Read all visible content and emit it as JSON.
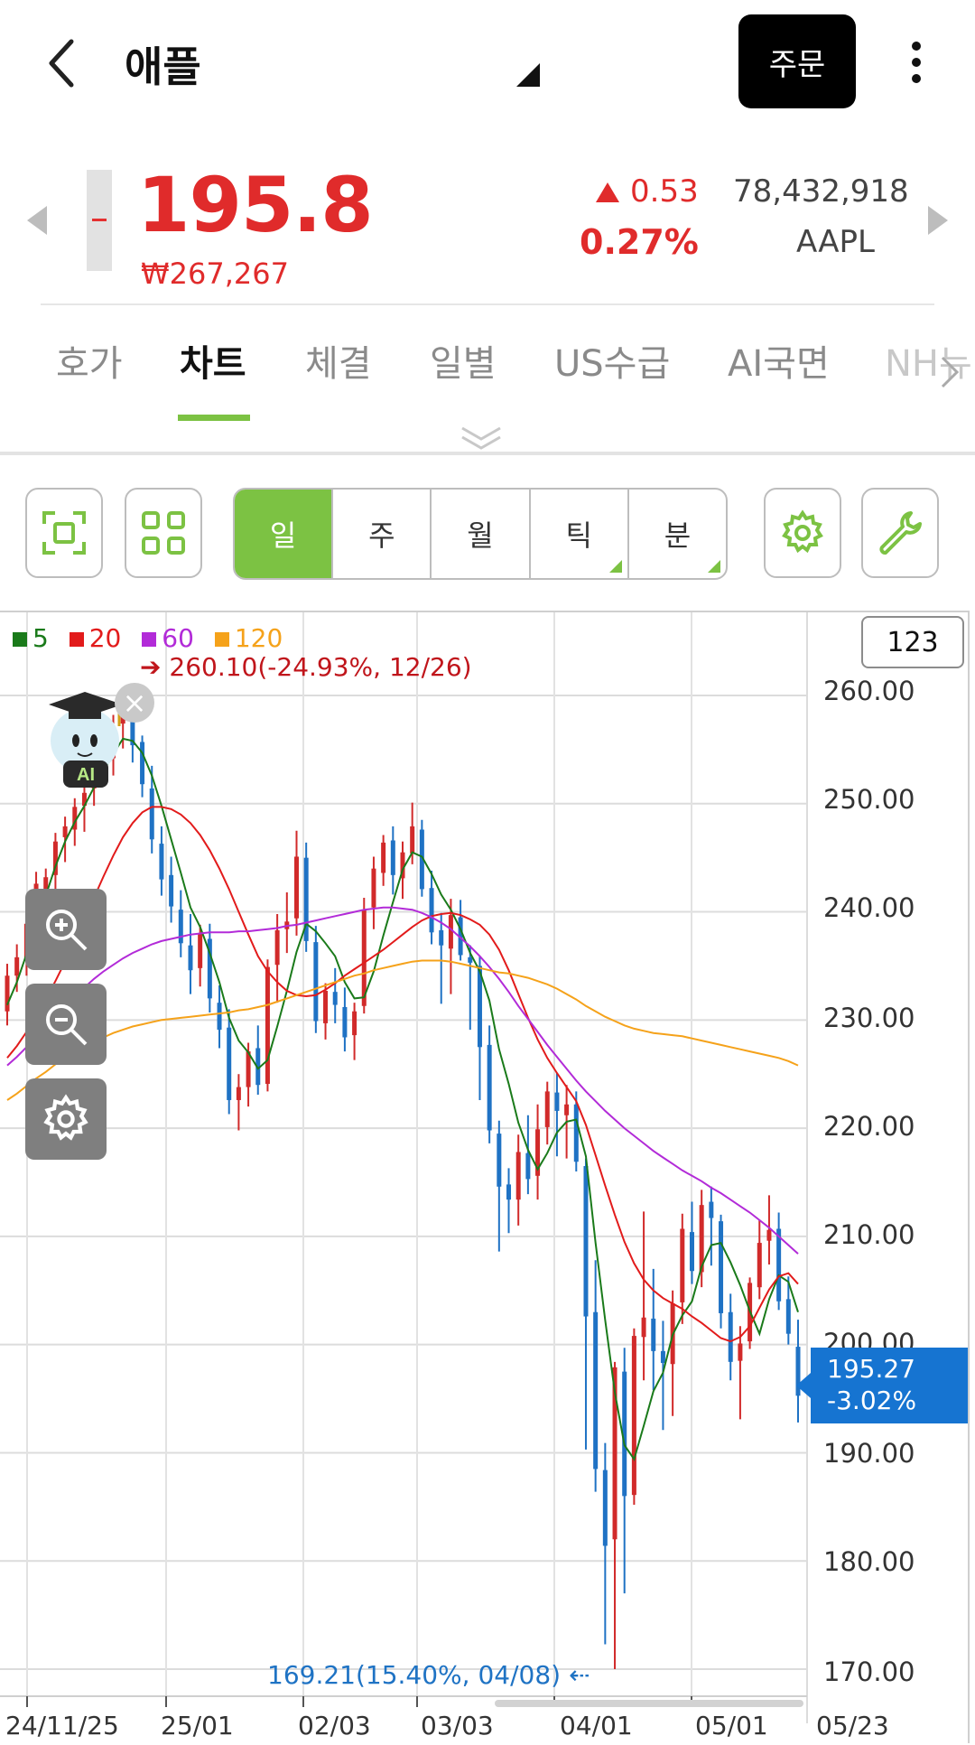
{
  "header": {
    "title": "애플",
    "order_label": "주문"
  },
  "quote": {
    "price": "195.8",
    "price_krw": "₩267,267",
    "change": "0.53",
    "change_pct": "0.27%",
    "volume": "78,432,918",
    "ticker": "AAPL"
  },
  "tabs": [
    "호가",
    "차트",
    "체결",
    "일별",
    "US수급",
    "AI국면",
    "NH뉴"
  ],
  "active_tab": "차트",
  "period_buttons": [
    "일",
    "주",
    "월",
    "틱",
    "분"
  ],
  "active_period": "일",
  "chart": {
    "legend": [
      {
        "label": "5",
        "color": "#1a7a1a"
      },
      {
        "label": "20",
        "color": "#e21b1b"
      },
      {
        "label": "60",
        "color": "#b22bd8"
      },
      {
        "label": "120",
        "color": "#f5a21a"
      }
    ],
    "count_button": "123",
    "high_note": "260.10(-24.93%, 12/26)",
    "low_note": "169.21(15.40%, 04/08)",
    "current_price": "195.27",
    "current_pct": "-3.02%",
    "ai_label": "AI"
  },
  "chart_data": {
    "type": "candlestick",
    "x_ticks": [
      "24/11/25",
      "25/01",
      "02/03",
      "03/03",
      "04/01",
      "05/01",
      "05/23"
    ],
    "y_ticks": [
      "260.00",
      "250.00",
      "240.00",
      "230.00",
      "220.00",
      "210.00",
      "200.00",
      "190.00",
      "180.00",
      "170.00"
    ],
    "ylim": [
      168,
      263
    ],
    "moving_averages": [
      "5",
      "20",
      "60",
      "120"
    ],
    "annotations": [
      "260.10(-24.93%, 12/26)",
      "169.21(15.40%, 04/08)"
    ],
    "last_value": 195.27,
    "up_color": "#d12a2a",
    "down_color": "#1f72c4",
    "candles": [
      [
        230.8,
        235.2,
        229.5,
        234.1
      ],
      [
        234.1,
        237.0,
        232.6,
        235.8
      ],
      [
        235.6,
        239.6,
        234.1,
        238.9
      ],
      [
        239.0,
        243.7,
        237.6,
        242.6
      ],
      [
        242.1,
        244.0,
        240.4,
        243.2
      ],
      [
        243.4,
        247.3,
        241.8,
        246.5
      ],
      [
        246.9,
        248.8,
        244.6,
        247.9
      ],
      [
        247.6,
        250.5,
        246.1,
        249.7
      ],
      [
        249.8,
        252.1,
        247.4,
        251.0
      ],
      [
        251.4,
        254.3,
        249.8,
        253.5
      ],
      [
        253.6,
        256.0,
        251.9,
        254.9
      ],
      [
        254.2,
        258.2,
        252.6,
        257.1
      ],
      [
        257.4,
        260.1,
        255.1,
        258.6
      ],
      [
        258.0,
        259.9,
        253.8,
        255.4
      ],
      [
        255.7,
        256.3,
        250.6,
        251.8
      ],
      [
        251.4,
        253.5,
        245.4,
        246.7
      ],
      [
        246.3,
        247.9,
        241.5,
        243.0
      ],
      [
        243.4,
        245.1,
        239.0,
        240.5
      ],
      [
        240.2,
        242.0,
        235.8,
        237.1
      ],
      [
        236.9,
        239.8,
        232.4,
        234.6
      ],
      [
        234.8,
        238.8,
        233.1,
        238.0
      ],
      [
        237.5,
        238.9,
        230.7,
        232.0
      ],
      [
        231.6,
        233.2,
        227.4,
        229.1
      ],
      [
        229.3,
        231.0,
        221.3,
        222.6
      ],
      [
        222.6,
        225.0,
        219.8,
        223.8
      ],
      [
        223.8,
        227.9,
        222.0,
        227.1
      ],
      [
        227.4,
        229.5,
        223.1,
        224.0
      ],
      [
        224.1,
        235.6,
        223.4,
        234.9
      ],
      [
        235.1,
        239.8,
        231.6,
        238.3
      ],
      [
        238.4,
        241.8,
        236.2,
        239.1
      ],
      [
        239.4,
        247.5,
        237.8,
        245.1
      ],
      [
        245.0,
        246.4,
        236.3,
        237.3
      ],
      [
        237.2,
        238.7,
        228.8,
        229.9
      ],
      [
        229.7,
        233.4,
        228.2,
        232.7
      ],
      [
        232.6,
        234.8,
        229.7,
        231.4
      ],
      [
        231.2,
        233.0,
        227.1,
        228.4
      ],
      [
        228.6,
        231.6,
        226.3,
        230.8
      ],
      [
        231.3,
        241.3,
        230.6,
        240.2
      ],
      [
        240.4,
        245.1,
        238.4,
        244.0
      ],
      [
        243.6,
        247.1,
        242.4,
        246.4
      ],
      [
        246.6,
        247.9,
        241.6,
        243.4
      ],
      [
        243.1,
        246.5,
        241.2,
        245.5
      ],
      [
        245.4,
        250.1,
        244.4,
        247.9
      ],
      [
        247.6,
        248.5,
        241.4,
        242.1
      ],
      [
        242.2,
        243.8,
        237.0,
        238.1
      ],
      [
        238.3,
        239.9,
        231.5,
        236.9
      ],
      [
        236.6,
        241.2,
        232.4,
        239.7
      ],
      [
        239.5,
        241.1,
        235.5,
        236.0
      ],
      [
        235.8,
        236.9,
        229.1,
        235.3
      ],
      [
        235.0,
        235.9,
        222.6,
        227.5
      ],
      [
        227.7,
        229.5,
        218.6,
        219.8
      ],
      [
        219.5,
        220.7,
        208.6,
        214.6
      ],
      [
        214.8,
        216.3,
        210.3,
        213.4
      ],
      [
        213.4,
        219.4,
        211.0,
        217.8
      ],
      [
        217.7,
        221.2,
        213.9,
        215.3
      ],
      [
        215.6,
        222.2,
        213.4,
        219.9
      ],
      [
        220.1,
        224.3,
        218.5,
        223.4
      ],
      [
        223.3,
        225.1,
        217.4,
        221.6
      ],
      [
        221.2,
        224.0,
        217.2,
        222.2
      ],
      [
        222.2,
        223.4,
        216.0,
        216.9
      ],
      [
        216.5,
        217.2,
        190.3,
        202.6
      ],
      [
        203.0,
        207.8,
        186.4,
        188.5
      ],
      [
        188.4,
        190.9,
        172.3,
        181.4
      ],
      [
        182.0,
        198.4,
        170.0,
        197.9
      ],
      [
        197.5,
        199.7,
        177.0,
        186.0
      ],
      [
        186.1,
        201.5,
        185.2,
        200.8
      ],
      [
        200.7,
        212.3,
        196.7,
        202.5
      ],
      [
        202.4,
        207.0,
        195.8,
        199.4
      ],
      [
        199.4,
        202.2,
        192.1,
        198.3
      ],
      [
        198.2,
        205.0,
        193.4,
        203.8
      ],
      [
        203.9,
        212.1,
        201.9,
        210.7
      ],
      [
        210.4,
        213.2,
        205.6,
        206.8
      ],
      [
        206.7,
        214.3,
        205.3,
        212.9
      ],
      [
        213.2,
        214.6,
        207.3,
        211.7
      ],
      [
        211.4,
        212.0,
        201.5,
        202.9
      ],
      [
        203.0,
        204.7,
        196.7,
        198.4
      ],
      [
        198.5,
        201.7,
        193.1,
        200.1
      ],
      [
        200.3,
        206.2,
        199.6,
        205.7
      ],
      [
        205.3,
        211.5,
        204.2,
        209.4
      ],
      [
        209.6,
        213.8,
        207.4,
        210.6
      ],
      [
        210.7,
        212.2,
        203.2,
        204.0
      ],
      [
        204.2,
        206.3,
        200.0,
        201.0
      ],
      [
        199.8,
        202.3,
        192.8,
        195.27
      ]
    ],
    "series": [
      {
        "name": "5",
        "color": "#1a7a1a",
        "values": [
          231.4,
          233.5,
          236.1,
          239.5,
          241.5,
          244.2,
          246.5,
          248.3,
          249.8,
          251.5,
          253.0,
          254.6,
          256.0,
          255.8,
          254.7,
          252.6,
          249.8,
          246.7,
          243.6,
          240.4,
          238.6,
          236.2,
          233.5,
          230.2,
          228.1,
          227.0,
          225.5,
          226.3,
          229.4,
          232.7,
          236.3,
          238.9,
          238.2,
          237.1,
          235.9,
          233.5,
          232.0,
          232.1,
          234.5,
          237.8,
          240.9,
          243.9,
          245.5,
          245.1,
          243.5,
          241.6,
          240.2,
          238.4,
          236.2,
          234.5,
          231.8,
          227.3,
          224.1,
          220.5,
          218.0,
          216.2,
          217.7,
          219.6,
          220.6,
          220.8,
          217.4,
          209.4,
          202.3,
          195.6,
          190.7,
          189.4,
          192.5,
          195.7,
          197.4,
          200.9,
          202.7,
          204.0,
          207.2,
          209.2,
          209.4,
          207.6,
          205.5,
          203.1,
          201.0,
          204.2,
          206.4,
          205.8,
          203.0
        ]
      },
      {
        "name": "20",
        "color": "#e21b1b",
        "values": [
          226.5,
          227.6,
          228.9,
          230.4,
          231.9,
          233.6,
          235.4,
          237.3,
          239.3,
          241.3,
          243.3,
          245.2,
          246.9,
          248.2,
          249.2,
          249.7,
          249.7,
          249.5,
          249.0,
          248.2,
          247.1,
          245.7,
          244.0,
          242.1,
          240.0,
          237.9,
          235.9,
          234.5,
          233.5,
          232.7,
          232.3,
          232.2,
          232.3,
          232.8,
          233.4,
          234.1,
          234.7,
          235.3,
          235.9,
          236.5,
          237.2,
          237.9,
          238.6,
          239.2,
          239.6,
          239.8,
          239.9,
          239.7,
          239.3,
          238.8,
          237.9,
          236.5,
          234.6,
          232.4,
          230.2,
          228.2,
          226.5,
          225.1,
          223.8,
          222.5,
          220.3,
          217.5,
          214.7,
          212.0,
          209.5,
          207.5,
          206.0,
          205.0,
          204.3,
          203.8,
          203.3,
          202.6,
          202.0,
          201.3,
          200.6,
          200.3,
          200.7,
          201.7,
          203.4,
          205.1,
          206.3,
          206.6,
          205.6
        ]
      },
      {
        "name": "60",
        "color": "#b22bd8",
        "values": [
          225.8,
          226.6,
          227.5,
          228.4,
          229.4,
          230.4,
          231.3,
          232.2,
          233.0,
          233.8,
          234.5,
          235.1,
          235.7,
          236.2,
          236.6,
          237.0,
          237.3,
          237.5,
          237.7,
          237.9,
          238.0,
          238.1,
          238.1,
          238.1,
          238.2,
          238.2,
          238.3,
          238.4,
          238.5,
          238.7,
          238.8,
          239.0,
          239.2,
          239.4,
          239.6,
          239.8,
          240.0,
          240.2,
          240.3,
          240.4,
          240.4,
          240.3,
          240.2,
          239.9,
          239.5,
          239.0,
          238.4,
          237.6,
          236.8,
          235.9,
          234.9,
          233.8,
          232.6,
          231.3,
          230.1,
          228.9,
          227.7,
          226.6,
          225.5,
          224.4,
          223.4,
          222.5,
          221.6,
          220.8,
          220.0,
          219.3,
          218.6,
          217.9,
          217.3,
          216.7,
          216.1,
          215.6,
          215.1,
          214.5,
          214.0,
          213.4,
          212.8,
          212.2,
          211.5,
          210.8,
          210.0,
          209.2,
          208.4
        ]
      },
      {
        "name": "120",
        "color": "#f5a21a",
        "values": [
          222.6,
          223.2,
          223.9,
          224.6,
          225.2,
          225.9,
          226.5,
          227.1,
          227.6,
          228.0,
          228.4,
          228.8,
          229.1,
          229.4,
          229.6,
          229.8,
          230.0,
          230.1,
          230.2,
          230.3,
          230.4,
          230.5,
          230.6,
          230.7,
          230.9,
          231.0,
          231.2,
          231.4,
          231.7,
          232.0,
          232.3,
          232.6,
          232.9,
          233.2,
          233.5,
          233.8,
          234.1,
          234.3,
          234.6,
          234.8,
          235.0,
          235.2,
          235.4,
          235.5,
          235.5,
          235.5,
          235.4,
          235.2,
          235.0,
          234.8,
          234.6,
          234.4,
          234.3,
          234.1,
          233.9,
          233.6,
          233.3,
          232.9,
          232.4,
          231.9,
          231.3,
          230.8,
          230.3,
          229.9,
          229.5,
          229.2,
          229.0,
          228.8,
          228.7,
          228.6,
          228.5,
          228.3,
          228.1,
          227.9,
          227.7,
          227.5,
          227.3,
          227.1,
          226.9,
          226.7,
          226.5,
          226.2,
          225.8
        ]
      }
    ]
  }
}
